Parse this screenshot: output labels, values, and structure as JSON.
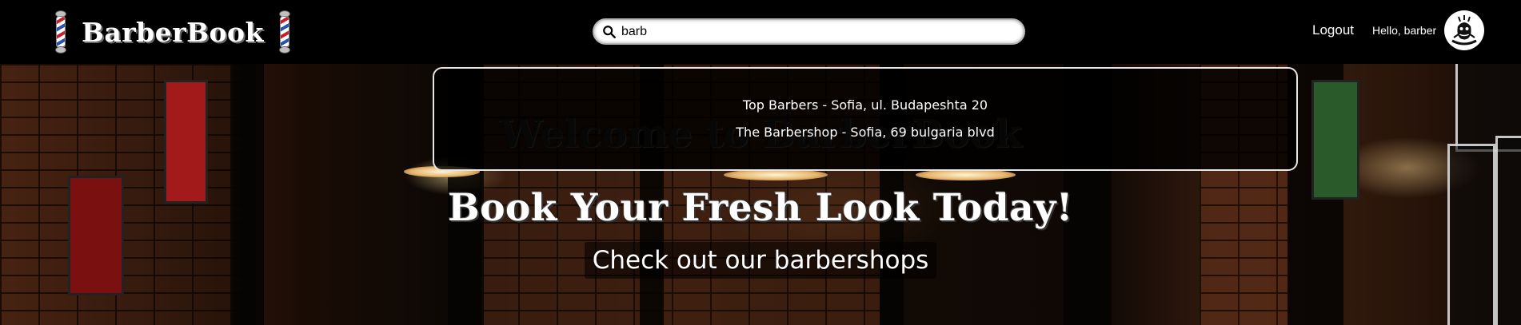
{
  "navbar": {
    "brand": "BarberBook",
    "search": {
      "value": "barb",
      "placeholder": ""
    },
    "logout_label": "Logout",
    "greeting": "Hello, barber"
  },
  "search_results": [
    {
      "label": "Top Barbers - Sofia, ul. Budapeshta 20"
    },
    {
      "label": "The Barbershop - Sofia, 69 bulgaria blvd"
    }
  ],
  "hero": {
    "welcome": "Welcome to BarberBook",
    "tagline": "Book Your Fresh Look Today!",
    "cta_label": "Check out our barbershops"
  },
  "icons": {
    "search": "search-icon",
    "barber_pole": "barber-pole-icon",
    "avatar": "barber-avatar"
  },
  "colors": {
    "navbar_bg": "#000000",
    "text": "#ffffff",
    "pole_red": "#cc1f2d",
    "pole_blue": "#2553b0"
  }
}
